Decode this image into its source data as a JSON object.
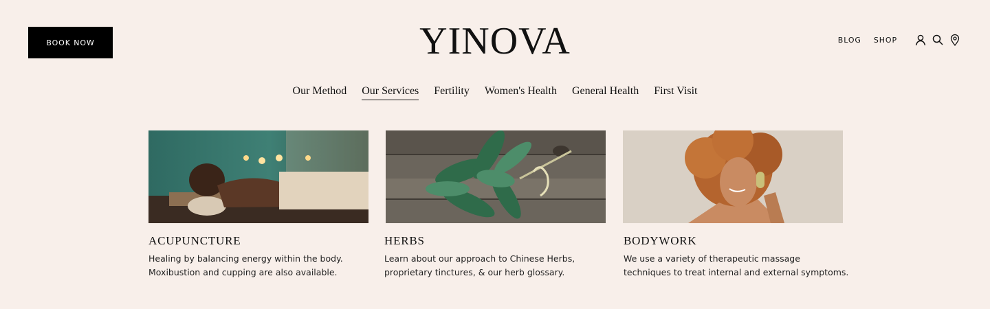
{
  "header": {
    "book_label": "BOOK NOW",
    "logo": "YINOVA",
    "links": [
      "BLOG",
      "SHOP"
    ],
    "icons": [
      "account-icon",
      "search-icon",
      "location-pin-icon"
    ]
  },
  "nav": {
    "items": [
      "Our Method",
      "Our Services",
      "Fertility",
      "Women's Health",
      "General Health",
      "First Visit"
    ],
    "active": "Our Services"
  },
  "cards": [
    {
      "title": "ACUPUNCTURE",
      "lines": [
        "Healing by balancing energy within the body.",
        "Moxibustion and cupping are also available."
      ],
      "image": "woman-relaxing-on-massage-table-with-candles"
    },
    {
      "title": "HERBS",
      "lines": [
        "Learn about our approach to Chinese Herbs,",
        "proprietary tinctures, & our herb glossary."
      ],
      "image": "sage-bundle-on-wood"
    },
    {
      "title": "BODYWORK",
      "lines": [
        "We use a variety of therapeutic massage",
        "techniques to treat internal and external symptoms."
      ],
      "image": "woman-using-jade-roller"
    }
  ],
  "colors": {
    "background": "#f8efea",
    "button": "#000000",
    "text": "#111111"
  }
}
